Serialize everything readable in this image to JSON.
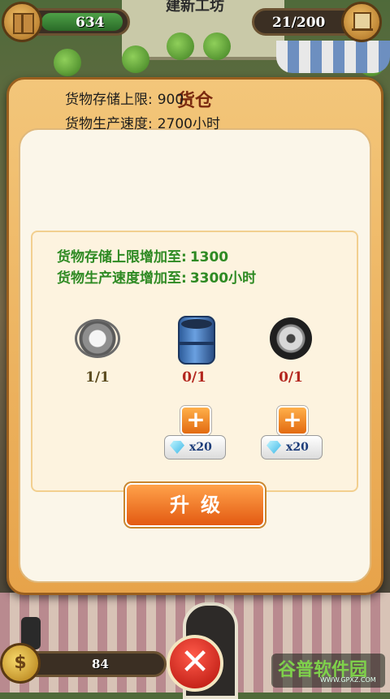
{
  "top_hud": {
    "title": "建新工坊",
    "left_value": "634",
    "right_value": "21/200",
    "left_icon": "crate-icon",
    "right_icon": "hand-truck-icon"
  },
  "dialog": {
    "title": "货仓",
    "storage_limit_label": "货物存储上限:",
    "storage_limit_value": "900",
    "production_speed_label": "货物生产速度:",
    "production_speed_value": "2700小时",
    "upgrade_storage_label": "货物存储上限增加至:",
    "upgrade_storage_value": "1300",
    "upgrade_speed_label": "货物生产速度增加至:",
    "upgrade_speed_value": "3300小时",
    "materials": [
      {
        "icon": "gear-icon",
        "count": "1/1"
      },
      {
        "icon": "oil-barrel-icon",
        "count": "0/1"
      },
      {
        "icon": "tire-icon",
        "count": "0/1"
      }
    ],
    "buy_buttons": [
      {
        "plus": "+",
        "cost": "x20"
      },
      {
        "plus": "+",
        "cost": "x20"
      }
    ],
    "upgrade_button": "升级"
  },
  "bottom_hud": {
    "coin_value": "84",
    "coin_symbol": "$",
    "close_symbol": "✕"
  },
  "watermark": {
    "main": "谷普软件园",
    "sub": "WWW.GPXZ.COM"
  },
  "colors": {
    "dialog_frame": "#e7a34a",
    "panel_bg": "#fbf6e9",
    "green_text": "#2e8a23",
    "red_count": "#b3261e",
    "upgrade_button": "#e35a12"
  }
}
